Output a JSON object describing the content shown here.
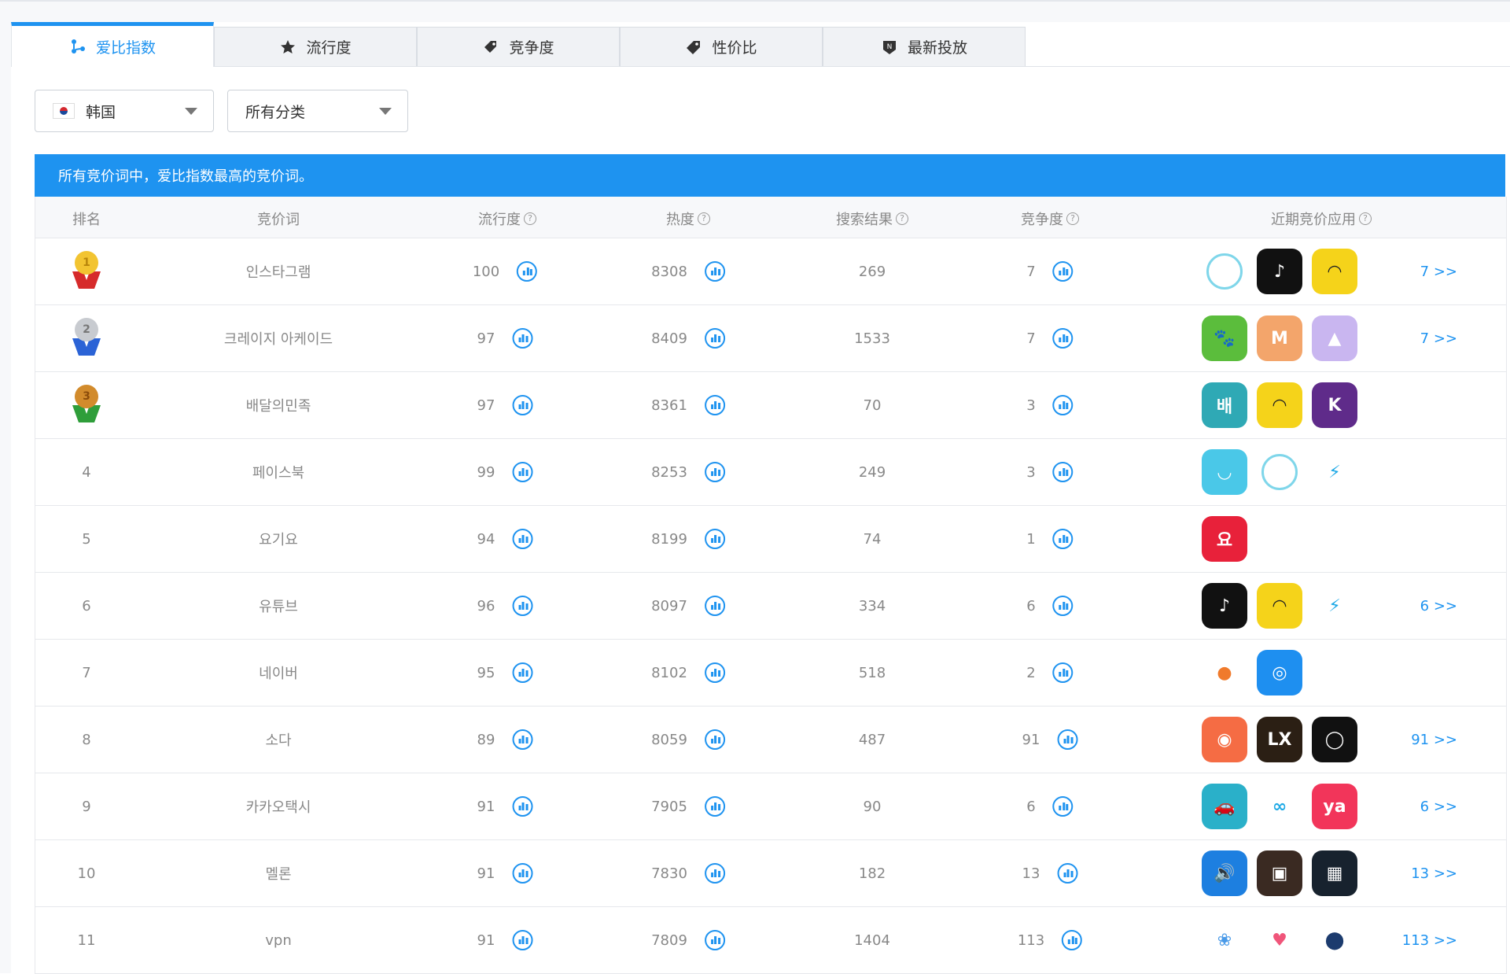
{
  "tabs": [
    {
      "label": "爱比指数",
      "icon": "network-icon",
      "active": true
    },
    {
      "label": "流行度",
      "icon": "star-icon",
      "active": false
    },
    {
      "label": "竞争度",
      "icon": "tag-icon",
      "active": false
    },
    {
      "label": "性价比",
      "icon": "price-tag-icon",
      "active": false
    },
    {
      "label": "最新投放",
      "icon": "new-badge-icon",
      "active": false
    }
  ],
  "filters": {
    "country": "韩国",
    "category": "所有分类"
  },
  "banner": "所有竞价词中，爱比指数最高的竞价词。",
  "columns": {
    "rank": "排名",
    "keyword": "竞价词",
    "popularity": "流行度",
    "heat": "热度",
    "results": "搜索结果",
    "competition": "竞争度",
    "apps": "近期竞价应用"
  },
  "rows": [
    {
      "rank": "1",
      "medal": "gold",
      "keyword": "인스타그램",
      "popularity": "100",
      "heat": "8308",
      "results": "269",
      "competition": "7",
      "more": "7 >>",
      "apps": [
        {
          "name": "ring-app-icon",
          "color": "#ffffff",
          "ring": "#7fd6ea"
        },
        {
          "name": "tiktok-icon",
          "color": "#111111",
          "glyph": "♪"
        },
        {
          "name": "yellow-smile-app-icon",
          "color": "#f5d31a",
          "glyph": "◠"
        }
      ]
    },
    {
      "rank": "2",
      "medal": "silver",
      "keyword": "크레이지 아케이드",
      "popularity": "97",
      "heat": "8409",
      "results": "1533",
      "competition": "7",
      "more": "7 >>",
      "apps": [
        {
          "name": "game-raccoon-icon",
          "color": "#5bbd3c",
          "glyph": "🐾"
        },
        {
          "name": "game-mushroom-icon",
          "color": "#f3a56b",
          "glyph": "M"
        },
        {
          "name": "pastel-shape-app-icon",
          "color": "#c9b6f0",
          "glyph": "▲"
        }
      ]
    },
    {
      "rank": "3",
      "medal": "bronze",
      "keyword": "배달의민족",
      "popularity": "97",
      "heat": "8361",
      "results": "70",
      "competition": "3",
      "more": "",
      "apps": [
        {
          "name": "baemin-icon",
          "color": "#2fa9b5",
          "glyph": "배"
        },
        {
          "name": "yellow-smile-app-icon",
          "color": "#f5d31a",
          "glyph": "◠"
        },
        {
          "name": "kurly-icon",
          "color": "#5f2b8a",
          "glyph": "K"
        }
      ]
    },
    {
      "rank": "4",
      "medal": "",
      "keyword": "페이스북",
      "popularity": "99",
      "heat": "8253",
      "results": "249",
      "competition": "3",
      "more": "",
      "apps": [
        {
          "name": "smile-app-icon",
          "color": "#4ac8e8",
          "glyph": "◡"
        },
        {
          "name": "ring-app-icon",
          "color": "#ffffff",
          "ring": "#7fd6ea"
        },
        {
          "name": "lightning-app-icon",
          "color": "#ffffff",
          "glyph": "⚡"
        }
      ]
    },
    {
      "rank": "5",
      "medal": "",
      "keyword": "요기요",
      "popularity": "94",
      "heat": "8199",
      "results": "74",
      "competition": "1",
      "more": "",
      "apps": [
        {
          "name": "yogiyo-icon",
          "color": "#e8213a",
          "glyph": "요"
        }
      ]
    },
    {
      "rank": "6",
      "medal": "",
      "keyword": "유튜브",
      "popularity": "96",
      "heat": "8097",
      "results": "334",
      "competition": "6",
      "more": "6 >>",
      "apps": [
        {
          "name": "tiktok-icon",
          "color": "#111111",
          "glyph": "♪"
        },
        {
          "name": "yellow-smile-app-icon",
          "color": "#f5d31a",
          "glyph": "◠"
        },
        {
          "name": "lightning-app-icon",
          "color": "#ffffff",
          "glyph": "⚡"
        }
      ]
    },
    {
      "rank": "7",
      "medal": "",
      "keyword": "네이버",
      "popularity": "95",
      "heat": "8102",
      "results": "518",
      "competition": "2",
      "more": "",
      "apps": [
        {
          "name": "carrot-app-icon",
          "color": "#ffffff",
          "glyph": "●"
        },
        {
          "name": "globe-app-icon",
          "color": "#1e8ff0",
          "glyph": "◎"
        }
      ]
    },
    {
      "rank": "8",
      "medal": "",
      "keyword": "소다",
      "popularity": "89",
      "heat": "8059",
      "results": "487",
      "competition": "91",
      "more": "91 >>",
      "apps": [
        {
          "name": "orange-drop-app-icon",
          "color": "#f56c44",
          "glyph": "◉"
        },
        {
          "name": "lx-app-icon",
          "color": "#2b1f14",
          "glyph": "LX"
        },
        {
          "name": "keyhole-app-icon",
          "color": "#111111",
          "glyph": "◯"
        }
      ]
    },
    {
      "rank": "9",
      "medal": "",
      "keyword": "카카오택시",
      "popularity": "91",
      "heat": "7905",
      "results": "90",
      "competition": "6",
      "more": "6 >>",
      "apps": [
        {
          "name": "car-app-icon",
          "color": "#2ab0c9",
          "glyph": "🚗"
        },
        {
          "name": "driver-app-icon",
          "color": "#ffffff",
          "glyph": "∞"
        },
        {
          "name": "ya-app-icon",
          "color": "#f2355a",
          "glyph": "ya"
        }
      ]
    },
    {
      "rank": "10",
      "medal": "",
      "keyword": "멜론",
      "popularity": "91",
      "heat": "7830",
      "results": "182",
      "competition": "13",
      "more": "13 >>",
      "apps": [
        {
          "name": "speaker-app-icon",
          "color": "#1d7fe0",
          "glyph": "🔊"
        },
        {
          "name": "dark-photo-app-icon",
          "color": "#3a2a22",
          "glyph": "▣"
        },
        {
          "name": "colorful-grid-app-icon",
          "color": "#17222e",
          "glyph": "▦"
        }
      ]
    },
    {
      "rank": "11",
      "medal": "",
      "keyword": "vpn",
      "popularity": "91",
      "heat": "7809",
      "results": "1404",
      "competition": "113",
      "more": "113 >>",
      "apps": [
        {
          "name": "lotus-app-icon",
          "color": "#ffffff",
          "glyph": "❀"
        },
        {
          "name": "heart-app-icon",
          "color": "#ffffff",
          "glyph": "♥"
        },
        {
          "name": "shield-pin-app-icon",
          "color": "#ffffff",
          "glyph": "⬤"
        }
      ]
    }
  ]
}
